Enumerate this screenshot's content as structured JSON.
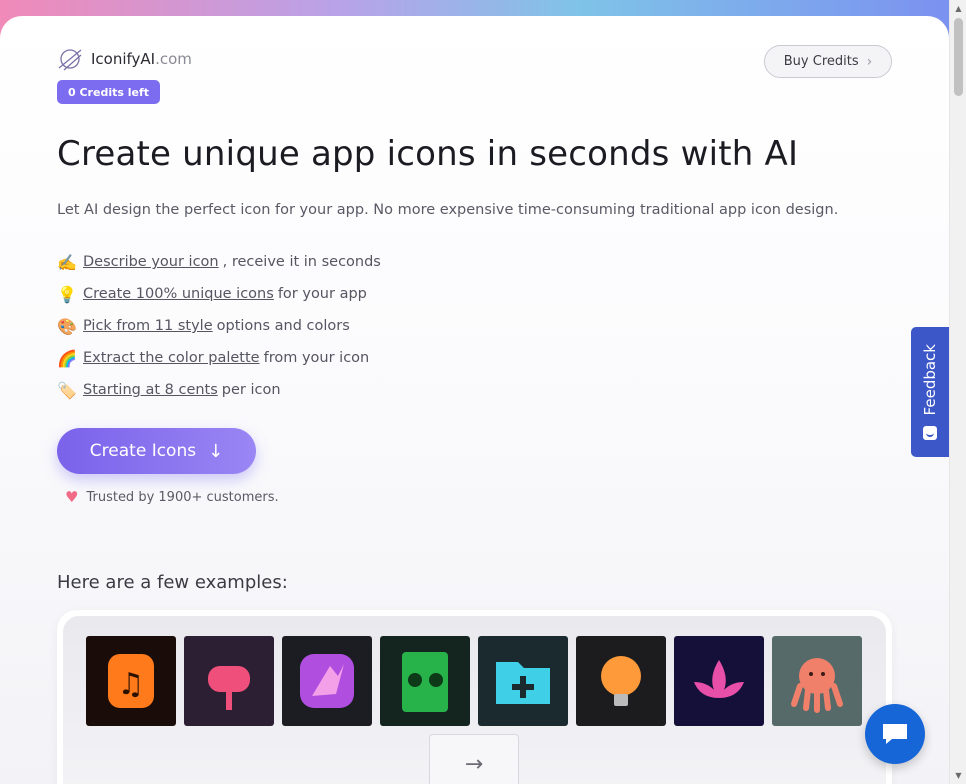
{
  "header": {
    "brand": "IconifyAI",
    "brand_domain": ".com",
    "credits_badge": "0 Credits left",
    "buy_button": "Buy Credits"
  },
  "hero": {
    "title": "Create unique app icons in seconds with AI",
    "lead": "Let AI design the perfect icon for your app. No more expensive time-consuming traditional app icon design."
  },
  "features": [
    {
      "emoji": "✍️",
      "link": "Describe your icon",
      "rest": ", receive it in seconds"
    },
    {
      "emoji": "💡",
      "link": "Create 100% unique icons",
      "rest": " for your app"
    },
    {
      "emoji": "🎨",
      "link": "Pick from 11 style",
      "rest": " options and colors"
    },
    {
      "emoji": "🌈",
      "link": "Extract the color palette",
      "rest": " from your icon"
    },
    {
      "emoji": "🏷️",
      "link": "Starting at 8 cents",
      "rest": " per icon"
    }
  ],
  "cta": {
    "label": "Create Icons",
    "icon": "arrow-down"
  },
  "trusted": {
    "icon": "heart",
    "text": "Trusted by 1900+ customers."
  },
  "examples": {
    "title": "Here are a few examples:",
    "tiles": [
      {
        "name": "music-note-fire-icon",
        "bg": "#1a0c08",
        "accent": "#ff7a1a"
      },
      {
        "name": "mailbox-icon",
        "bg": "#2c1e33",
        "accent": "#ef4f7b"
      },
      {
        "name": "bird-icon",
        "bg": "#1b1d22",
        "accent": "#b04ee0"
      },
      {
        "name": "money-book-icon",
        "bg": "#14241e",
        "accent": "#27b24a"
      },
      {
        "name": "folder-plus-icon",
        "bg": "#1a2a2e",
        "accent": "#3fd0e8"
      },
      {
        "name": "light-bulb-icon",
        "bg": "#1c1c1e",
        "accent": "#ff9a3a"
      },
      {
        "name": "lotus-icon",
        "bg": "#15103a",
        "accent": "#e84fa8"
      },
      {
        "name": "octopus-icon",
        "bg": "#566a6a",
        "accent": "#f0806a"
      }
    ],
    "next_icon": "arrow-right"
  },
  "feedback": {
    "label": "Feedback"
  },
  "colors": {
    "accent": "#7c6cf0",
    "feedback": "#3b57c8",
    "chat": "#1666d8"
  }
}
